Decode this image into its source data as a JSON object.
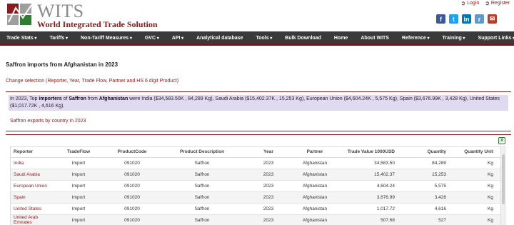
{
  "header": {
    "logo_title": "WITS",
    "logo_subtitle": "World Integrated Trade Solution",
    "login_label": "Login",
    "register_label": "Register",
    "social": [
      {
        "icon": "facebook-icon",
        "glyph": "f",
        "color": "#3b5998"
      },
      {
        "icon": "twitter-icon",
        "glyph": "t",
        "color": "#1da1f2"
      },
      {
        "icon": "linkedin-icon",
        "glyph": "in",
        "color": "#0077b5"
      },
      {
        "icon": "reddit-icon",
        "glyph": "r",
        "color": "#5f99cf"
      },
      {
        "icon": "email-icon",
        "glyph": "✉",
        "color": "#c0392b"
      }
    ]
  },
  "nav": {
    "left": [
      {
        "label": "Trade Stats",
        "dropdown": true
      },
      {
        "label": "Tariffs",
        "dropdown": true
      },
      {
        "label": "Non-Tariff Measures",
        "dropdown": true
      },
      {
        "label": "GVC",
        "dropdown": true
      },
      {
        "label": "API",
        "dropdown": true
      },
      {
        "label": "Analytical database",
        "dropdown": false
      },
      {
        "label": "Tools",
        "dropdown": true
      },
      {
        "label": "Bulk Download",
        "dropdown": false
      }
    ],
    "right": [
      {
        "label": "Home",
        "dropdown": false
      },
      {
        "label": "About WITS",
        "dropdown": false
      },
      {
        "label": "Reference",
        "dropdown": true
      },
      {
        "label": "Training",
        "dropdown": true
      },
      {
        "label": "Support Links",
        "dropdown": true
      }
    ]
  },
  "content": {
    "page_title": "Saffron imports from Afghanistan in 2023",
    "change_selection": "Change selection (Reporter, Year, Trade Flow, Partner and HS 6 digit Product)",
    "summary_parts": [
      {
        "text": "In 2023, Top ",
        "bold": false
      },
      {
        "text": "importers",
        "bold": true
      },
      {
        "text": " of ",
        "bold": false
      },
      {
        "text": "Saffron",
        "bold": true
      },
      {
        "text": " from ",
        "bold": false
      },
      {
        "text": "Afghanistan",
        "bold": true
      },
      {
        "text": " were India ($34,583.50K , 84,289 Kg), Saudi Arabia ($15,402.37K , 15,253 Kg), European Union ($4,604.24K , 5,575 Kg), Spain ($3,676.99K , 3,428 Kg), United States ($1,017.72K , 4,616 Kg).",
        "bold": false
      }
    ],
    "exports_link": "Saffron exports by country in 2023"
  },
  "table": {
    "columns": [
      "Reporter",
      "TradeFlow",
      "ProductCode",
      "Product Description",
      "Year",
      "Partner",
      "Trade Value 1000USD",
      "Quantity",
      "Quantity Unit"
    ],
    "rows": [
      [
        "India",
        "Import",
        "091020",
        "Saffron",
        "2023",
        "Afghanistan",
        "34,583.50",
        "84,289",
        "Kg"
      ],
      [
        "Saudi Arabia",
        "Import",
        "091020",
        "Saffron",
        "2023",
        "Afghanistan",
        "15,402.37",
        "15,253",
        "Kg"
      ],
      [
        "European Union",
        "Import",
        "091020",
        "Saffron",
        "2023",
        "Afghanistan",
        "4,604.24",
        "5,575",
        "Kg"
      ],
      [
        "Spain",
        "Import",
        "091020",
        "Saffron",
        "2023",
        "Afghanistan",
        "3,676.99",
        "3,428",
        "Kg"
      ],
      [
        "United States",
        "Import",
        "091020",
        "Saffron",
        "2023",
        "Afghanistan",
        "1,017.72",
        "4,616",
        "Kg"
      ],
      [
        "United Arab Emirates",
        "Import",
        "091020",
        "Saffron",
        "2023",
        "Afghanistan",
        "507.68",
        "527",
        "Kg"
      ]
    ]
  },
  "colors": {
    "brand": "#8c1a1a",
    "nav_bg": "#3a3a3a",
    "summary_highlight": "#e0daf0"
  }
}
